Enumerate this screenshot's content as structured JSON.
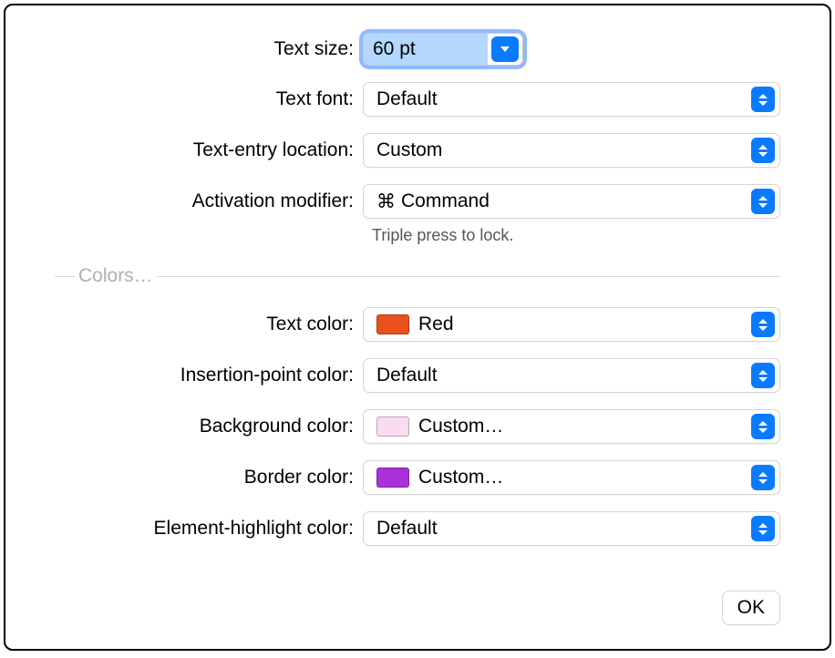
{
  "labels": {
    "textSize": "Text size:",
    "textFont": "Text font:",
    "textEntryLocation": "Text-entry location:",
    "activationModifier": "Activation modifier:",
    "activationHint": "Triple press to lock.",
    "colorsSection": "Colors…",
    "textColor": "Text color:",
    "insertionPointColor": "Insertion-point color:",
    "backgroundColor": "Background color:",
    "borderColor": "Border color:",
    "elementHighlightColor": "Element-highlight color:",
    "ok": "OK"
  },
  "values": {
    "textSize": "60 pt",
    "textFont": "Default",
    "textEntryLocation": "Custom",
    "activationModifierSymbol": "⌘",
    "activationModifierName": "Command",
    "textColorName": "Red",
    "textColorSwatch": "#e9501d",
    "insertionPointColor": "Default",
    "backgroundColorName": "Custom…",
    "backgroundColorSwatch": "#f9dcf2",
    "borderColorName": "Custom…",
    "borderColorSwatch": "#a832d8",
    "elementHighlightColor": "Default"
  }
}
